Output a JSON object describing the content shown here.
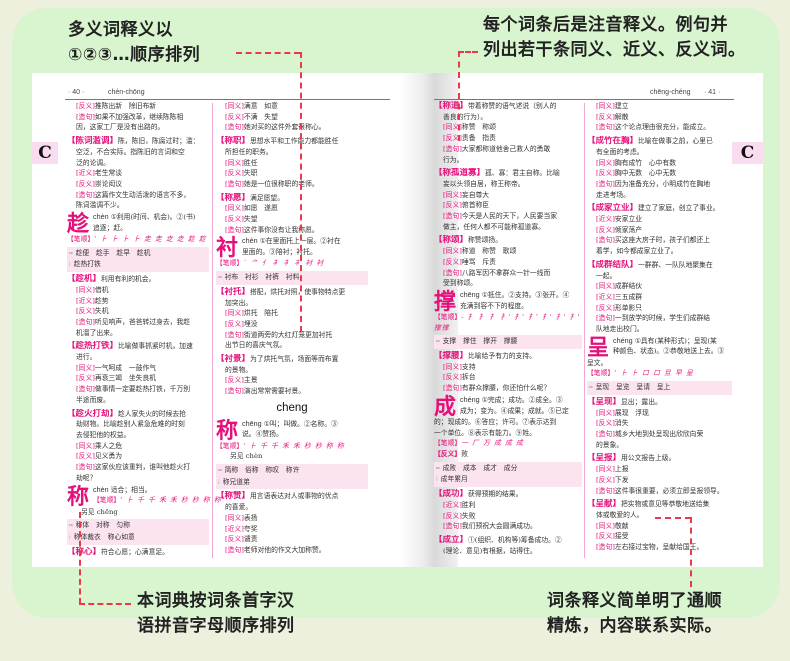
{
  "callouts": {
    "top_left": [
      "多义词释义以",
      "①②③…顺序排列"
    ],
    "top_right": [
      "每个词条后是注音释义。例句并",
      "列出若干条同义、近义、反义词。"
    ],
    "bottom_left": [
      "本词典按词条首字汉",
      "语拼音字母顺序排列"
    ],
    "bottom_right": [
      "词条释义简单明了通顺",
      "精炼，内容联系实际。"
    ]
  },
  "colors": {
    "accent": "#e5117b",
    "panel": "#d9f5d0",
    "background": "#eef0de",
    "dash": "#e83a4a",
    "tab": "#f9dcef"
  },
  "left_page": {
    "page_number": "· 40 ·",
    "pinyin_range": "chén-chōng",
    "section_letter": "C",
    "col1": {
      "l1": "[反义]",
      "l1t": "推陈出新　除旧布新",
      "l2": "[造句]",
      "l2t": "如果不加强改革，继续陈陈相",
      "l2c": "因，这家工厂是没有出路的。",
      "e1": "【陈词滥调】",
      "e1t": "陈，陈旧，陈腐过时；滥：",
      "e1c1": "空泛，不合实际。指陈旧的言词和空",
      "e1c2": "泛的论调。",
      "e1a": "[近义]",
      "e1at": "老生常谈",
      "e1b": "[反义]",
      "e1bt": "崇论闳议",
      "e1d": "[造句]",
      "e1dt": "这篇作文生动活泼的语言不多，",
      "e1dc": "陈词滥调不少。",
      "c1": "趁",
      "c1p": "chèn",
      "c1d1": "①利用(时间、机会)。②(书)",
      "c1d2": "追逐；赶。",
      "c1s": "【笔顺】",
      "c1st": "' ⺊ ⺊ ⺊ ⺊ 走 走 赱 赱 趁 趁",
      "c1w1": "趁便　趁手　趁早　趁机",
      "c1w2": "趁热打铁",
      "e2": "【趁机】",
      "e2t": "利用有利的机会。",
      "e2a": "[同义]",
      "e2at": "借机",
      "e2b": "[近义]",
      "e2bt": "趁势",
      "e2c": "[反义]",
      "e2ct": "失机",
      "e2d": "[造句]",
      "e2dt": "听见响声，爸爸转过身去，我趁",
      "e2dc": "机溜了出来。",
      "e3": "【趁热打铁】",
      "e3t": "比喻做事抓紧时机，加速",
      "e3c": "进行。",
      "e3a": "[同义]",
      "e3at": "一气呵成　一鼓作气",
      "e3b": "[反义]",
      "e3bt": "再衰三竭　坐失良机",
      "e3d": "[造句]",
      "e3dt": "做事情一定要趁热打铁，千万别",
      "e3dc": "半途而废。",
      "e4": "【趁火打劫】",
      "e4t": "趁人家失火的时候去抢",
      "e4c1": "劫财物。比喻趁别人紧急危难的时刻",
      "e4c2": "去侵犯他的权益。",
      "e4a": "[同义]",
      "e4at": "乘人之危",
      "e4b": "[反义]",
      "e4bt": "见义勇为",
      "e4d": "[造句]",
      "e4dt": "这家伙应该重判，谁叫他趁火打",
      "e4dc": "劫呢？",
      "c2": "称",
      "c2p": "chèn",
      "c2d1": "适合；相当。",
      "c2s": "【笔顺】",
      "c2st": "' ⺊ 千 千 禾 禾 秒 秒 称 称",
      "c2see": "另见 chēng",
      "c2w1": "称体　对称　匀称",
      "c2w2": "称体裁衣　称心如意",
      "e5": "【称心】",
      "e5t": "符合心愿；心满意足。"
    },
    "col2": {
      "a": "[同义]",
      "at": "满意　如意",
      "b": "[反义]",
      "bt": "不满　失望",
      "d": "[造句]",
      "dt": "她对买的这件外套很称心。",
      "e1": "【称职】",
      "e1t": "思想水平和工作能力都能胜任",
      "e1c": "所担任的职务。",
      "e1a": "[同义]",
      "e1at": "胜任",
      "e1b": "[反义]",
      "e1bt": "失职",
      "e1d": "[造句]",
      "e1dt": "她是一位很称职的老师。",
      "e2": "【称愿】",
      "e2t": "满足愿望。",
      "e2a": "[同义]",
      "e2at": "如愿　遂愿",
      "e2b": "[反义]",
      "e2bt": "失望",
      "e2d": "[造句]",
      "e2dt": "这件事你没有让我称愿。",
      "c1": "衬",
      "c1p": "chèn",
      "c1d1": "①在里面托上一层。②衬在",
      "c1d2": "里面的。③陪衬；衬托。",
      "c1s": "【笔顺】",
      "c1st": "` ⺈ 亻 衤 衤 衤 衬 衬",
      "c1w1": "衬布　衬衫　衬裤　衬料",
      "e3": "【衬托】",
      "e3t": "搭配，烘托对照，使事物特点更",
      "e3c": "加突出。",
      "e3a": "[同义]",
      "e3at": "烘托　陪托",
      "e3b": "[反义]",
      "e3bt": "埋没",
      "e3d": "[造句]",
      "e3dt": "街道两旁的大红灯笼更加衬托",
      "e3dc": "出节日的喜庆气氛。",
      "e4": "【衬景】",
      "e4t": "为了烘托气氛，场面等而布置",
      "e4c": "的景物。",
      "e4b": "[反义]",
      "e4bt": "主景",
      "e4d": "[造句]",
      "e4dt": "演出常常需要衬景。",
      "section": "cheng",
      "c2": "称",
      "c2p": "chēng",
      "c2d1": "①叫；叫做。②名称。③",
      "c2d2": "说。④赞扬。",
      "c2s": "【笔顺】",
      "c2st": "' ⺊ 千 千 禾 禾 秒 秒 称 称",
      "c2see": "另见 chèn",
      "c2w1": "简称　俗称　称叹　称许",
      "c2w2": "称兄道弟",
      "e5": "【称赞】",
      "e5t": "用言语表达对人或事物的优点",
      "e5c": "的喜爱。",
      "e5a": "[同义]",
      "e5at": "表扬",
      "e5b": "[近义]",
      "e5bt": "夸奖",
      "e5c2": "[反义]",
      "e5ct": "谴责",
      "e5d": "[造句]",
      "e5dt": "老师对他的作文大加称赞。"
    }
  },
  "right_page": {
    "page_number": "· 41 ·",
    "pinyin_range": "chēng-chéng",
    "section_letter": "C",
    "col1": {
      "e1": "【称道】",
      "e1t": "带着称赞的语气述说（别人的",
      "e1c": "善良的行为）。",
      "e1a": "[同义]",
      "e1at": "称赞　称颂",
      "e1b": "[反义]",
      "e1bt": "责备　指责",
      "e1d": "[造句]",
      "e1dt": "大家都称道他舍己救人的勇敢",
      "e1dc": "行为。",
      "e2": "【称孤道寡】",
      "e2t": "孤、寡：君主自称。比喻",
      "e2c": "妄以头领自居，称王称帝。",
      "e2a": "[同义]",
      "e2at": "妄自尊大",
      "e2b": "[反义]",
      "e2bt": "俯首称臣",
      "e2d": "[造句]",
      "e2dt": "今天是人民的天下，人民要当家",
      "e2dc": "做主，任何人都不可能称孤道寡。",
      "e3": "【称颂】",
      "e3t": "称赞颂扬。",
      "e3a": "[同义]",
      "e3at": "称道　称赞　歌颂",
      "e3b": "[反义]",
      "e3bt": "唾骂　斥责",
      "e3d": "[造句]",
      "e3dt": "八路军因不拿群众一针一线而",
      "e3dc": "受到称颂。",
      "c1": "撑",
      "c1p": "chēng",
      "c1d1": "①抵住。②支持。③张开。④",
      "c1d2": "充满到容不下的程度。",
      "c1s": "【笔顺】",
      "c1st": "- 扌 扌 扌 扌' 扌' 扌' 扌' 扌' 扌' 扌' 撑",
      "c1sc": "撑撑",
      "c1w1": "支撑　撑住　撑开　撑腰",
      "e4": "【撑腰】",
      "e4t": "比喻给予有力的支持。",
      "e4a": "[同义]",
      "e4at": "支持",
      "e4b": "[反义]",
      "e4bt": "拆台",
      "e4d": "[造句]",
      "e4dt": "有群众撑腰，你还怕什么呢？",
      "c2": "成",
      "c2p": "chéng",
      "c2d1": "①完成；成功。②成全。③",
      "c2d2": "成为；变为。④成果；成就。⑤已定",
      "c2c1": "的；现成的。⑥答应；许可。⑦表示达到",
      "c2c2": "一个单位。⑧表示有能力。⑨姓。",
      "c2s": "【笔顺】",
      "c2st": "一 厂 万 成 成 成",
      "c2f": "【反义】",
      "c2ft": "败",
      "c2w1": "成败　成本　成才　成分",
      "c2w2": "成年累月",
      "e5": "【成功】",
      "e5t": "获得预期的结果。",
      "e5a": "[近义]",
      "e5at": "胜利",
      "e5b": "[反义]",
      "e5bt": "失败",
      "e5d": "[造句]",
      "e5dt": "我们预祝大会圆满成功。",
      "e6": "【成立】",
      "e6t": "①(组织、机构等)筹备成功。②",
      "e6c": "(理论、意见)有根据，站得住。"
    },
    "col2": {
      "a": "[同义]",
      "at": "建立",
      "b": "[反义]",
      "bt": "解散",
      "d": "[造句]",
      "dt": "这个论点理由很充分，能成立。",
      "e1": "【成竹在胸】",
      "e1t": "比喻在做事之前，心里已",
      "e1c": "有全面的考虑。",
      "e1a": "[同义]",
      "e1at": "胸有成竹　心中有数",
      "e1b": "[反义]",
      "e1bt": "胸中无数　心中无数",
      "e1d": "[造句]",
      "e1dt": "因为准备充分，小明成竹在胸地",
      "e1dc": "走进考场。",
      "e2": "【成家立业】",
      "e2t": "建立了家庭，创立了事业。",
      "e2a": "[近义]",
      "e2at": "安家立业",
      "e2b": "[反义]",
      "e2bt": "倾家荡产",
      "e2d": "[造句]",
      "e2dt": "买这座大房子时，孩子们都还上",
      "e2dc": "着学，如今都成家立业了。",
      "e3": "【成群结队】",
      "e3t": "一群群、一队队地聚集在",
      "e3c": "一起。",
      "e3a": "[同义]",
      "e3at": "成群结伙",
      "e3a2": "[近义]",
      "e3a2t": "三五成群",
      "e3b": "[反义]",
      "e3bt": "形单影只",
      "e3d": "[造句]",
      "e3dt": "一到放学的时候，学生们成群结",
      "e3dc": "队地走出校门。",
      "c1": "呈",
      "c1p": "chéng",
      "c1d1": "①具有(某种形式)；呈现(某",
      "c1d2": "种颜色、状态)。②恭敬地送上去。③",
      "c1c": "呈文。",
      "c1s": "【笔顺】",
      "c1st": "' ⺊ ⺊ 口 口 旦 早 呈",
      "c1w1": "呈现　呈览　呈请　呈上",
      "e4": "【呈现】",
      "e4t": "显出；露出。",
      "e4a": "[同义]",
      "e4at": "展现　浮现",
      "e4b": "[反义]",
      "e4bt": "消失",
      "e4d": "[造句]",
      "e4dt": "城乡大地到处呈现出欣欣向荣",
      "e4dc": "的景象。",
      "e5": "【呈报】",
      "e5t": "用公文报告上级。",
      "e5a": "[同义]",
      "e5at": "上报",
      "e5b": "[反义]",
      "e5bt": "下发",
      "e5d": "[造句]",
      "e5dt": "这件事很重要，必须立即呈报领导。",
      "e6": "【呈献】",
      "e6t": "把实物或意见等恭敬地送给集",
      "e6c": "体或敬爱的人。",
      "e6a": "[同义]",
      "e6at": "敬献",
      "e6b": "[反义]",
      "e6bt": "接受",
      "e6d": "[造句]",
      "e6dt": "左右接过宝物，呈献给国王。"
    }
  }
}
